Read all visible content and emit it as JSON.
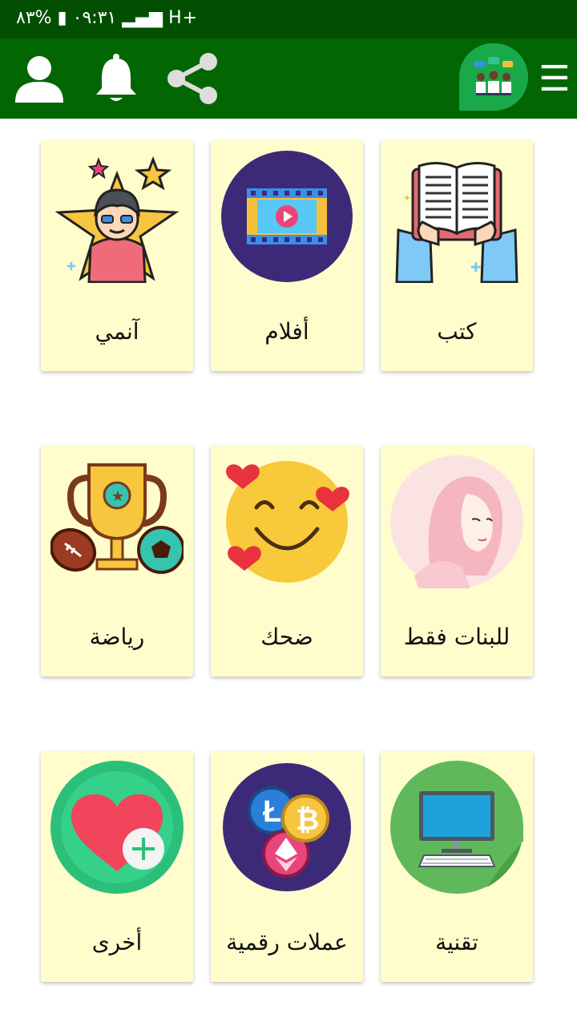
{
  "status_bar": {
    "text": "٠٩:٣١ ▮ %٨٣ ▂▄▆ H+"
  },
  "header": {
    "menu_icon": "☰"
  },
  "categories": [
    {
      "label": "كتب",
      "icon": "book-icon"
    },
    {
      "label": "أفلام",
      "icon": "film-icon"
    },
    {
      "label": "آنمي",
      "icon": "anime-icon"
    },
    {
      "label": "للبنات فقط",
      "icon": "hijab-girl-icon"
    },
    {
      "label": "ضحك",
      "icon": "laughing-emoji-icon"
    },
    {
      "label": "رياضة",
      "icon": "trophy-icon"
    },
    {
      "label": "تقنية",
      "icon": "computer-icon"
    },
    {
      "label": "عملات رقمية",
      "icon": "crypto-coins-icon"
    },
    {
      "label": "أخرى",
      "icon": "heart-plus-icon"
    }
  ],
  "colors": {
    "status_bar": "#024f02",
    "app_bar": "#026602",
    "card_bg": "#fffdcc",
    "logo_bg": "#1aa94a"
  }
}
